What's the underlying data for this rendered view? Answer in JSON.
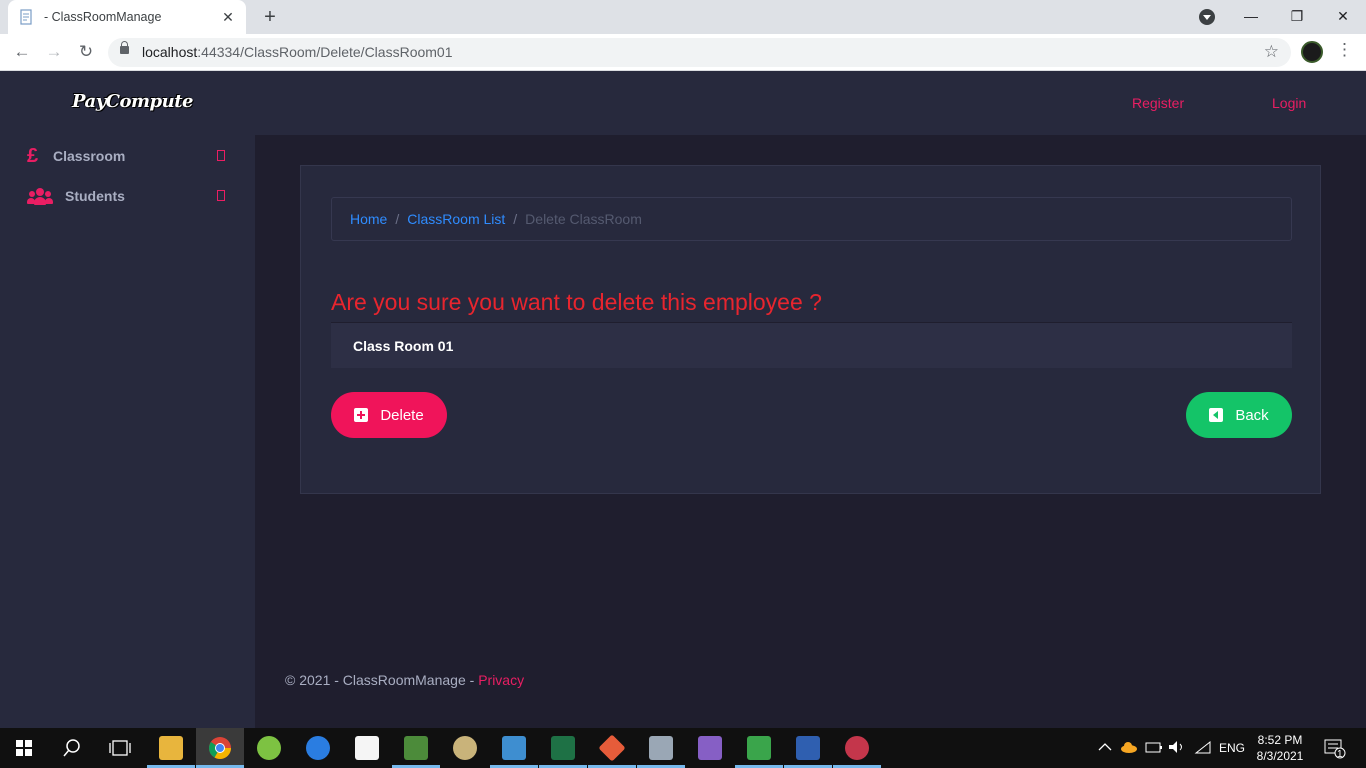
{
  "browser": {
    "tab_title": "- ClassRoomManage",
    "tab_close": "✕",
    "new_tab": "+",
    "url_host": "localhost",
    "url_rest": ":44334/ClassRoom/Delete/ClassRoom01",
    "back_icon": "←",
    "forward_icon": "→",
    "reload_icon": "↻",
    "star_icon": "☆",
    "menu_icon": "⋮",
    "minimize": "—",
    "maximize": "❐",
    "close": "✕"
  },
  "header": {
    "logo": "PayCompute",
    "register": "Register",
    "login": "Login"
  },
  "sidebar": {
    "items": [
      {
        "icon": "pound-icon",
        "label": "Classroom"
      },
      {
        "icon": "users-icon",
        "label": "Students"
      }
    ],
    "pound_glyph": "£"
  },
  "breadcrumb": {
    "home": "Home",
    "list": "ClassRoom List",
    "current": "Delete ClassRoom",
    "separator": "/"
  },
  "main": {
    "warning": "Are you sure you want to delete this employee ?",
    "item_name": "Class Room 01",
    "delete_label": "Delete",
    "back_label": "Back"
  },
  "footer": {
    "text": "© 2021 - ClassRoomManage - ",
    "privacy": "Privacy"
  },
  "taskbar": {
    "lang": "ENG",
    "time": "8:52 PM",
    "date": "8/3/2021",
    "notification_count": "1"
  },
  "colors": {
    "accent": "#e91e63",
    "delete": "#f0145a",
    "back": "#14c468",
    "warning": "#e8252e",
    "link": "#2f8cff"
  }
}
